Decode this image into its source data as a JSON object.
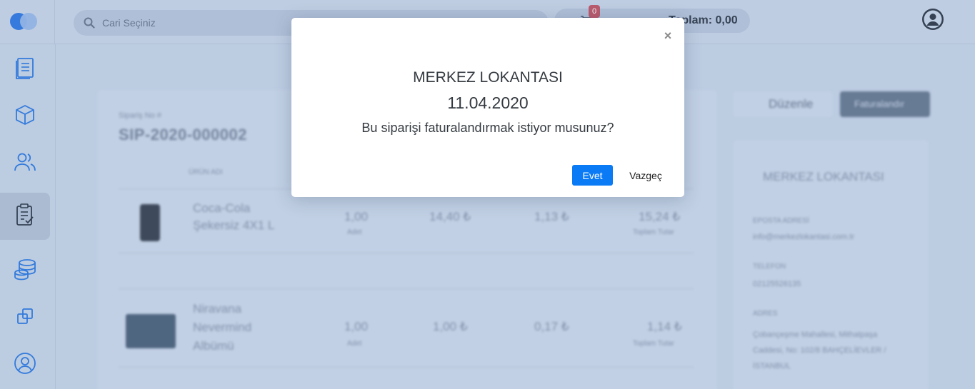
{
  "topbar": {
    "search_placeholder": "Cari Seçiniz",
    "cart_count": "0",
    "total_label": "Toplam: 0,00"
  },
  "sidebar": {
    "items": [
      {
        "icon": "invoice-icon"
      },
      {
        "icon": "box-icon"
      },
      {
        "icon": "users-icon"
      },
      {
        "icon": "orders-icon",
        "active": true
      },
      {
        "icon": "coins-icon"
      },
      {
        "icon": "copy-icon"
      },
      {
        "icon": "profile-icon"
      }
    ]
  },
  "background": {
    "order_no_label": "Sipariş No #",
    "order_no": "SIP-2020-000002",
    "column_header": "ÜRÜN ADI",
    "items": [
      {
        "name": "Coca-Cola Şekersiz 4X1 L",
        "qty": "1,00",
        "qty_label": "Adet",
        "price": "14,40 ₺",
        "tax": "1,13 ₺",
        "total": "15,24 ₺",
        "total_label": "Toplam Tutar"
      },
      {
        "name": "Niravana Nevermind Albümü",
        "qty": "1,00",
        "qty_label": "Adet",
        "price": "1,00 ₺",
        "tax": "0,17 ₺",
        "total": "1,14 ₺",
        "total_label": "Toplam Tutar"
      }
    ],
    "edit_button": "Düzenle",
    "invoiced_button": "Faturalandır",
    "customer_name": "MERKEZ LOKANTASI",
    "email_label": "EPOSTA ADRESİ",
    "email": "info@merkezlokantasi.com.tr",
    "phone_label": "TELEFON",
    "phone": "02125526135",
    "address_label": "ADRES",
    "address": "Çobançeşme Mahallesi, Mithatpaşa Caddesi, No: 102/8 BAHÇELİEVLER / İSTANBUL"
  },
  "modal": {
    "title": "MERKEZ LOKANTASI",
    "date": "11.04.2020",
    "question": "Bu siparişi faturalandırmak istiyor musunuz?",
    "yes_label": "Evet",
    "no_label": "Vazgeç",
    "close_glyph": "×"
  }
}
